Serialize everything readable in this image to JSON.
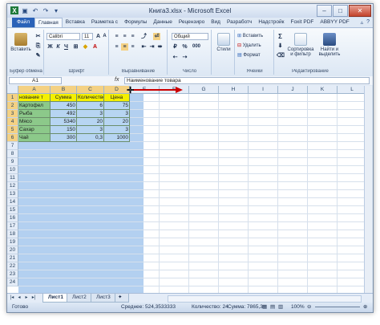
{
  "window": {
    "title": "Книга3.xlsx - Microsoft Excel"
  },
  "qat_icons": [
    "excel-logo-icon",
    "save-icon",
    "undo-icon",
    "redo-icon",
    "customize-qat-icon"
  ],
  "tabs": [
    "Файл",
    "Главная",
    "Вставка",
    "Разметка с",
    "Формулы",
    "Данные",
    "Рецензиро",
    "Вид",
    "Разработч",
    "Надстройк",
    "Foxit PDF",
    "ABBYY PDF"
  ],
  "ribbon": {
    "clipboard": {
      "paste_label": "Вставить",
      "group_label": "Буфер обмена"
    },
    "font": {
      "font_name": "Calibri",
      "font_size": "11",
      "group_label": "Шрифт",
      "bold": "Ж",
      "italic": "К",
      "underline": "Ч"
    },
    "alignment": {
      "group_label": "Выравнивание"
    },
    "number": {
      "format": "Общий",
      "group_label": "Число",
      "percent": "%",
      "thousands": "000"
    },
    "styles": {
      "label": "Стили"
    },
    "cells": {
      "insert": "Вставить",
      "delete": "Удалить",
      "format": "Формат",
      "group_label": "Ячейки"
    },
    "editing": {
      "sort": "Сортировка",
      "sort2": "и фильтр",
      "find": "Найти и",
      "find2": "выделить",
      "group_label": "Редактирование",
      "sum": "Σ"
    }
  },
  "formula_bar": {
    "name_box": "A1",
    "fx": "fx",
    "content": "Наименование товара"
  },
  "columns": [
    "A",
    "B",
    "C",
    "D",
    "E",
    "F",
    "G",
    "H",
    "I",
    "J",
    "K",
    "L"
  ],
  "rows": [
    "1",
    "2",
    "3",
    "4",
    "5",
    "6",
    "7",
    "8",
    "9",
    "10",
    "11",
    "12",
    "13",
    "14",
    "15",
    "16",
    "17",
    "18",
    "19",
    "20",
    "21",
    "22",
    "23",
    "24"
  ],
  "table": {
    "header": [
      "нование т",
      "Сумма",
      "Количество",
      "Цена"
    ],
    "rows": [
      [
        "Картофел",
        "450",
        "6",
        "75"
      ],
      [
        "Рыба",
        "492",
        "3",
        "3"
      ],
      [
        "Мясо",
        "5340",
        "20",
        "20"
      ],
      [
        "Сахар",
        "150",
        "3",
        "3"
      ],
      [
        "Чай",
        "300",
        "0,3",
        "1000"
      ]
    ]
  },
  "sheets": [
    "Лист1",
    "Лист2",
    "Лист3"
  ],
  "status": {
    "ready": "Готово",
    "average": "Среднее: 524,3533333",
    "count": "Количество: 24",
    "sum": "Сумма: 7865,3",
    "zoom": "100%"
  },
  "colors": {
    "accent": "#2a62b8",
    "header_fill": "#f4f000",
    "name_fill": "#8cc98a",
    "selection": "#b3d0f0",
    "arrow": "#cc0000"
  }
}
